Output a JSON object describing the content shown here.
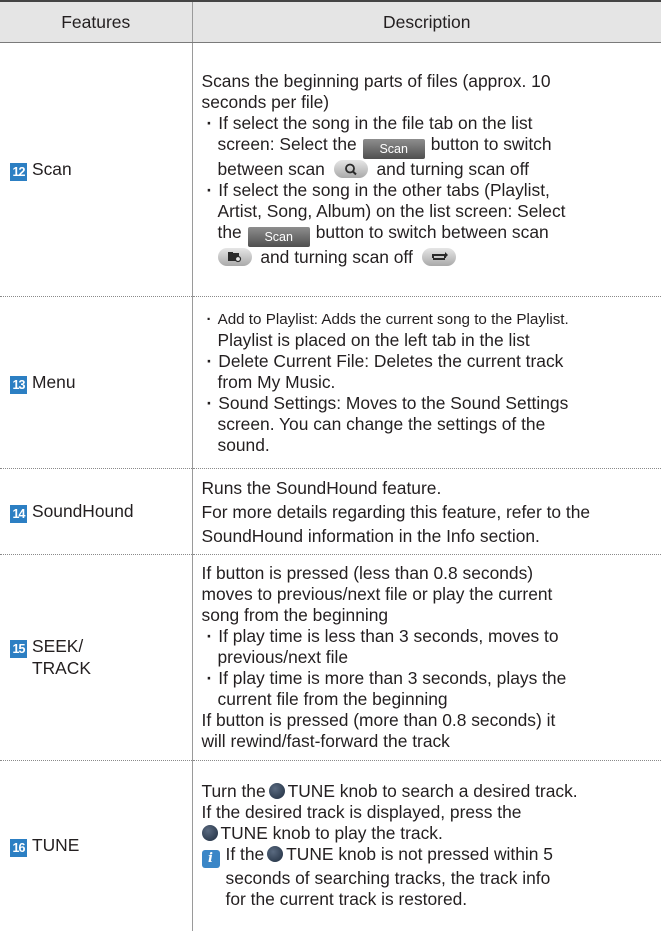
{
  "header": {
    "col1": "Features",
    "col2": "Description"
  },
  "rows": [
    {
      "num": "12",
      "feature": "Scan",
      "l1": "Scans the beginning parts of files (approx. 10",
      "l2": "seconds per file)",
      "b1a": "If select the song in the file tab on the list",
      "b1b": "screen: Select the",
      "b1c": "button to switch",
      "b1d": "between scan",
      "b1e": "and turning scan off",
      "b2a": "If select the song in the other tabs (Playlist,",
      "b2b": "Artist, Song, Album) on the list screen: Select",
      "b2c": "the",
      "b2d": "button to switch between scan",
      "b2e": "and turning scan off",
      "scan_button_label": "Scan"
    },
    {
      "num": "13",
      "feature": "Menu",
      "b1a": "Add to Playlist: Adds the current song to the Playlist.",
      "b1b": "Playlist is placed on the left tab in the list",
      "b2a": "Delete Current File: Deletes the current track",
      "b2b": "from My Music.",
      "b3a": "Sound Settings: Moves to the Sound Settings",
      "b3b": "screen. You can change the settings of the",
      "b3c": "sound."
    },
    {
      "num": "14",
      "feature": "SoundHound",
      "l1": "Runs the SoundHound feature.",
      "l2": "For more details regarding this feature, refer to the",
      "l3": "SoundHound information in the Info section."
    },
    {
      "num": "15",
      "feature_line1": "SEEK/",
      "feature_line2": "TRACK",
      "l1": "If button is pressed (less than 0.8 seconds)",
      "l2": "moves to previous/next file or play the current",
      "l3": "song from the beginning",
      "b1a": "If play time is less than 3 seconds, moves to",
      "b1b": "previous/next file",
      "b2a": "If play time is more than 3 seconds, plays the",
      "b2b": "current file from the beginning",
      "l4": "If button is pressed (more than 0.8 seconds) it",
      "l5": "will rewind/fast-forward the track"
    },
    {
      "num": "16",
      "feature": "TUNE",
      "l1a": "Turn the",
      "l1b": "TUNE knob to search a desired track.",
      "l2": "If the desired track is displayed, press the",
      "l3": "TUNE knob to play the track.",
      "n1a": "If the",
      "n1b": "TUNE knob is not pressed within 5",
      "n2": "seconds of searching tracks, the track info",
      "n3": "for the current track is restored.",
      "info_icon_label": "i"
    }
  ],
  "icons": {
    "scan_file": "magnifier-scan-icon",
    "scan_folder": "folder-scan-icon",
    "scan_off": "repeat-off-icon",
    "tune_knob": "tune-knob-icon",
    "info": "info-icon"
  },
  "colors": {
    "header_bg": "#e5e5e5",
    "number_badge": "#2c7fc3",
    "info_badge": "#3a86c7"
  }
}
